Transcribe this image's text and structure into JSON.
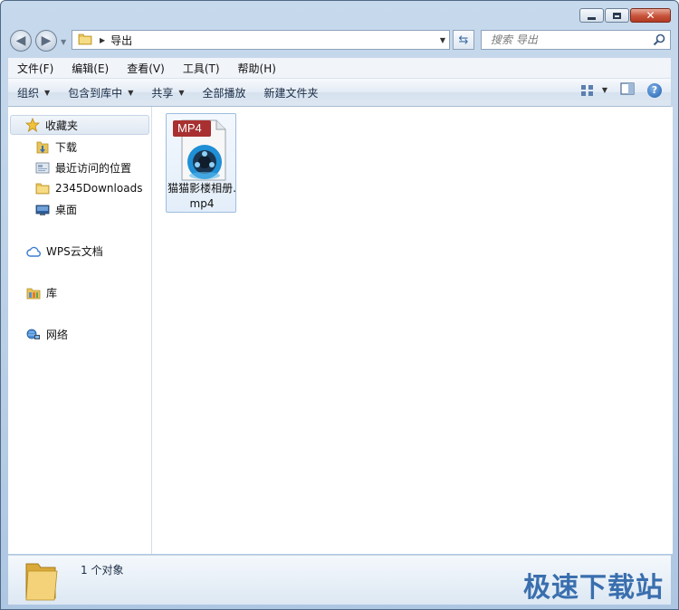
{
  "window": {
    "close_glyph": "✕"
  },
  "address": {
    "crumb": "导出"
  },
  "search": {
    "placeholder": "搜索 导出"
  },
  "menubar": {
    "items": [
      "文件(F)",
      "编辑(E)",
      "查看(V)",
      "工具(T)",
      "帮助(H)"
    ]
  },
  "toolbar": {
    "organize": "组织",
    "include_library": "包含到库中",
    "share": "共享",
    "play_all": "全部播放",
    "new_folder": "新建文件夹"
  },
  "navpane": {
    "favorites": "收藏夹",
    "downloads": "下载",
    "recent": "最近访问的位置",
    "downloads2345": "2345Downloads",
    "desktop": "桌面",
    "wps": "WPS云文档",
    "libraries": "库",
    "network": "网络"
  },
  "files": [
    {
      "name": "猫猫影楼相册.mp4",
      "badge": "MP4"
    }
  ],
  "status": {
    "count": "1 个对象"
  },
  "watermark": "极速下载站"
}
